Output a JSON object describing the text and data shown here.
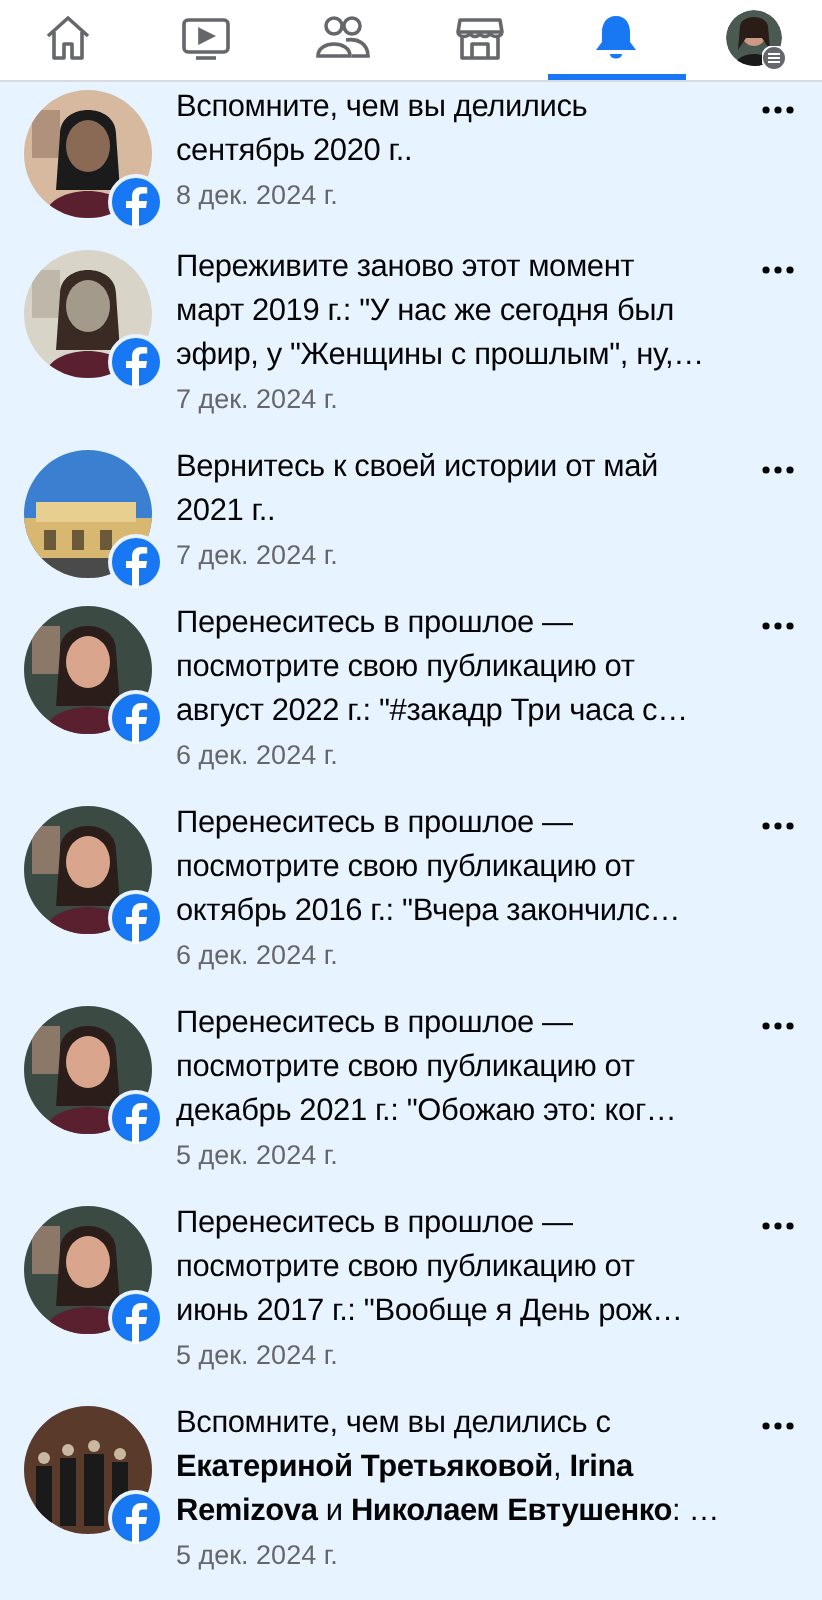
{
  "tabs": [
    {
      "kind": "home",
      "selected": false
    },
    {
      "kind": "video",
      "selected": false
    },
    {
      "kind": "friends",
      "selected": false
    },
    {
      "kind": "marketplace",
      "selected": false
    },
    {
      "kind": "notifications",
      "selected": true
    },
    {
      "kind": "profile",
      "selected": false
    }
  ],
  "notifications": [
    {
      "text": "Вспомните, чем вы делились\nсентябрь 2020 г..",
      "time": "8 дек. 2024 г.",
      "unread": true
    },
    {
      "text": "Переживите заново этот момент\nмарт 2019 г.: \"У нас же сегодня был\nэфир, у \"Женщины с прошлым\", ну,…",
      "time": "7 дек. 2024 г.",
      "unread": true
    },
    {
      "text": "Вернитесь к своей истории от май\n2021 г..",
      "time": "7 дек. 2024 г.",
      "unread": true
    },
    {
      "text": "Перенеситесь в прошлое —\nпосмотрите свою публикацию от\nавгуст 2022 г.: \"#закадр Три часа с…",
      "time": "6 дек. 2024 г.",
      "unread": true
    },
    {
      "text": "Перенеситесь в прошлое —\nпосмотрите свою публикацию от\nоктябрь 2016 г.: \"Вчера закончилс…",
      "time": "6 дек. 2024 г.",
      "unread": true
    },
    {
      "text": "Перенеситесь в прошлое —\nпосмотрите свою публикацию от\nдекабрь 2021 г.: \"Обожаю это: ког…",
      "time": "5 дек. 2024 г.",
      "unread": true
    },
    {
      "text": "Перенеситесь в прошлое —\nпосмотрите свою публикацию от\nиюнь 2017 г.: \"Вообще я День рож…",
      "time": "5 дек. 2024 г.",
      "unread": true
    },
    {
      "text": "Вспомните, чем вы делились с\n**Екатериной Третьяковой**, **Irina\nRemizova** и **Николаем Евтушенко**: …",
      "time": "5 дек. 2024 г.",
      "unread": true
    }
  ]
}
